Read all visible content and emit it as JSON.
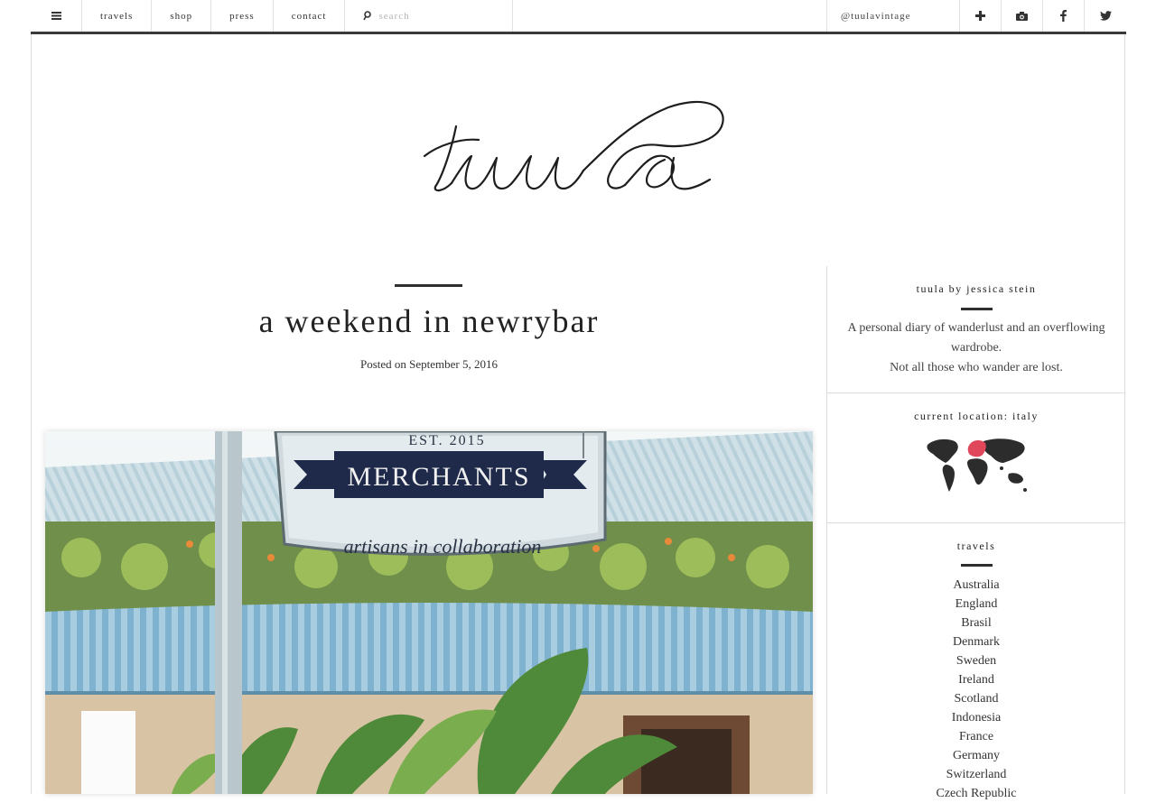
{
  "nav": {
    "menu_icon": "hamburger-menu-icon",
    "links": [
      "travels",
      "shop",
      "press",
      "contact"
    ],
    "search_placeholder": "search",
    "handle": "@tuulavintage",
    "social_icons": [
      "plus-icon",
      "camera-icon",
      "facebook-icon",
      "twitter-icon"
    ]
  },
  "logo": {
    "text": "tuula"
  },
  "post": {
    "title": "a weekend in newrybar",
    "meta": "Posted on September 5, 2016",
    "image": {
      "sign_est": "EST. 2015",
      "sign_title": "MERCHANTS",
      "sign_subtitle": "artisans in collaboration"
    }
  },
  "sidebar": {
    "about": {
      "title": "tuula by jessica stein",
      "line1": "A personal diary of wanderlust and an overflowing wardrobe.",
      "line2": "Not all those who wander are lost."
    },
    "location": {
      "title": "current location: italy",
      "highlight_color": "#e0475a"
    },
    "travels": {
      "title": "travels",
      "items": [
        "Australia",
        "England",
        "Brasil",
        "Denmark",
        "Sweden",
        "Ireland",
        "Scotland",
        "Indonesia",
        "France",
        "Germany",
        "Switzerland",
        "Czech Republic"
      ]
    }
  }
}
